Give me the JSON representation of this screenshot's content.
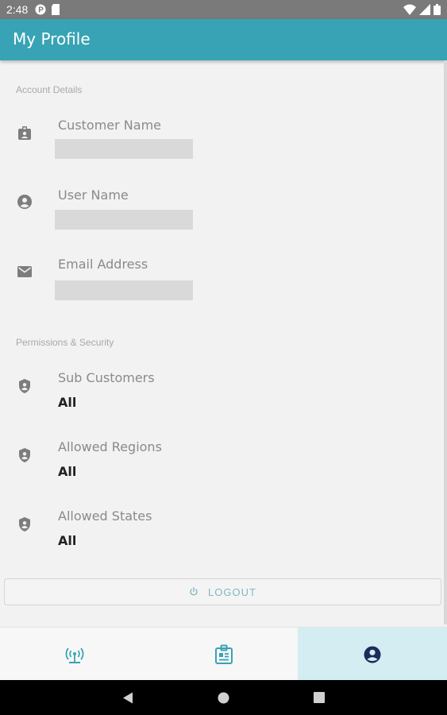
{
  "status_bar": {
    "time": "2:48"
  },
  "app_bar": {
    "title": "My Profile"
  },
  "account_section": {
    "header": "Account Details",
    "fields": [
      {
        "label": "Customer Name",
        "icon": "badge-icon"
      },
      {
        "label": "User Name",
        "icon": "account-circle-icon"
      },
      {
        "label": "Email Address",
        "icon": "mail-icon"
      }
    ]
  },
  "permissions_section": {
    "header": "Permissions & Security",
    "fields": [
      {
        "label": "Sub Customers",
        "value": "All",
        "icon": "shield-icon"
      },
      {
        "label": "Allowed Regions",
        "value": "All",
        "icon": "shield-icon"
      },
      {
        "label": "Allowed States",
        "value": "All",
        "icon": "shield-icon"
      }
    ]
  },
  "logout": {
    "label": "LOGOUT"
  },
  "bottom_nav": {
    "items": [
      {
        "icon": "antenna-icon",
        "active": false
      },
      {
        "icon": "id-badge-icon",
        "active": false
      },
      {
        "icon": "account-circle-icon",
        "active": true
      }
    ]
  },
  "colors": {
    "primary": "#38a3b4",
    "active_tab_bg": "#d3edf2",
    "active_icon": "#1c2a5c",
    "logout_text": "#7fb8c2"
  }
}
